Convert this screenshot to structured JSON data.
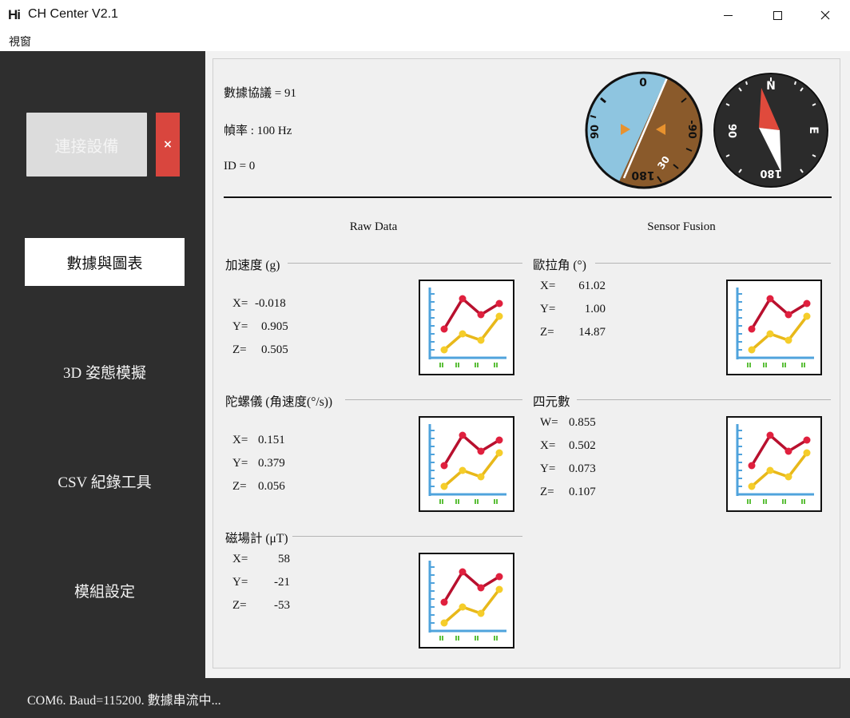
{
  "window": {
    "logo": "Hi",
    "title": "CH Center V2.1"
  },
  "menu": {
    "items": [
      "視窗"
    ]
  },
  "sidebar": {
    "connect_label": "連接設備",
    "disconnect_label": "×",
    "nav": [
      {
        "label": "數據與圖表",
        "active": true
      },
      {
        "label": "3D 姿態模擬",
        "active": false
      },
      {
        "label": "CSV 紀錄工具",
        "active": false
      },
      {
        "label": "模組設定",
        "active": false
      }
    ]
  },
  "info": {
    "protocol": "數據協議 = 91",
    "frame_rate": "幀率 : 100 Hz",
    "id": "ID = 0"
  },
  "attitude_gauge": {
    "top_mark": "0",
    "left_mark": "90",
    "right_mark": "-90",
    "bottom_mark": "180",
    "roll_mark": "30",
    "sky_color": "#8ec5e0",
    "ground_color": "#8a5a2b",
    "pointer_color": "#e8922e"
  },
  "compass": {
    "n": "N",
    "e": "E",
    "s": "180",
    "w": "90",
    "needle_north_color": "#e04a3c",
    "needle_south_color": "#ffffff",
    "face_color": "#2b2b2b"
  },
  "sections": {
    "raw_title": "Raw Data",
    "fusion_title": "Sensor Fusion"
  },
  "groups": {
    "accel": {
      "title": "加速度 (g)",
      "rows": [
        {
          "label": "X=",
          "value": "-0.018"
        },
        {
          "label": "Y=",
          "value": "0.905"
        },
        {
          "label": "Z=",
          "value": "0.505"
        }
      ]
    },
    "gyro": {
      "title": "陀螺儀 (角速度(°/s))",
      "rows": [
        {
          "label": "X=",
          "value": "0.151"
        },
        {
          "label": "Y=",
          "value": "0.379"
        },
        {
          "label": "Z=",
          "value": "0.056"
        }
      ]
    },
    "mag": {
      "title": "磁場計 (μT)",
      "rows": [
        {
          "label": "X=",
          "value": "58"
        },
        {
          "label": "Y=",
          "value": "-21"
        },
        {
          "label": "Z=",
          "value": "-53"
        }
      ]
    },
    "euler": {
      "title": "歐拉角 (°)",
      "rows": [
        {
          "label": "X=",
          "value": "61.02"
        },
        {
          "label": "Y=",
          "value": "1.00"
        },
        {
          "label": "Z=",
          "value": "14.87"
        }
      ]
    },
    "quat": {
      "title": "四元數",
      "rows": [
        {
          "label": "W=",
          "value": "0.855"
        },
        {
          "label": "X=",
          "value": "0.502"
        },
        {
          "label": "Y=",
          "value": "0.073"
        },
        {
          "label": "Z=",
          "value": "0.107"
        }
      ]
    }
  },
  "chart_icon": {
    "axis_color": "#4fa3dc",
    "red_line": "#b8102e",
    "yellow_line": "#e8b81a",
    "tick_color": "#5cbf3a"
  },
  "status": {
    "text": "COM6. Baud=115200. 數據串流中..."
  }
}
